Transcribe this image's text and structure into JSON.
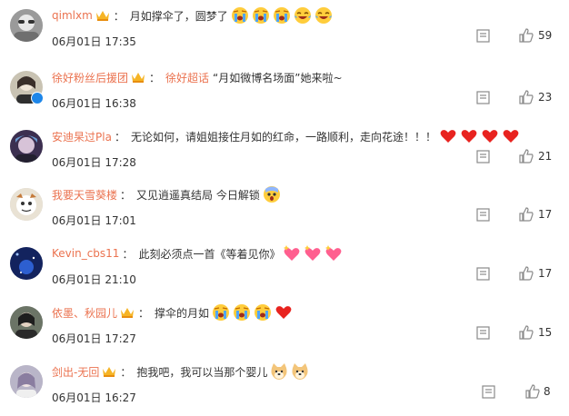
{
  "comments": [
    {
      "user": "qimlxm",
      "crown": true,
      "text": "月如撑伞了，圆梦了",
      "emojis": [
        "cry-face",
        "cry-face",
        "cry-face",
        "laugh-tears",
        "laugh-tears"
      ],
      "time": "06月01日 17:35",
      "likes": "59",
      "avatar": "#8a8a8a"
    },
    {
      "user": "徐好粉丝后援团",
      "crown": true,
      "verified": true,
      "mention": "徐好超话",
      "text": "“月如微博名场面”她来啦~",
      "emojis": [],
      "time": "06月01日 16:38",
      "likes": "23",
      "avatar": "#b7b3a6"
    },
    {
      "user": "安迪杲过Pla",
      "crown": false,
      "text": "无论如何，请姐姐接住月如的红命，一路顺利，走向花途！！！",
      "emojis": [
        "red-heart",
        "red-heart",
        "red-heart",
        "red-heart"
      ],
      "time": "06月01日 17:28",
      "likes": "21",
      "avatar": "#5a4b6b"
    },
    {
      "user": "我要天雪葵楼",
      "crown": false,
      "text": "又见逍遥真结局 今日解锁",
      "emojis": [
        "scared-face"
      ],
      "time": "06月01日 17:01",
      "likes": "17",
      "avatar": "#d8cfc0"
    },
    {
      "user": "Kevin_cbs11",
      "crown": false,
      "text": "此刻必须点一首《等着见你》",
      "emojis": [
        "sparkle-heart",
        "sparkle-heart",
        "sparkle-heart"
      ],
      "time": "06月01日 21:10",
      "likes": "17",
      "avatar": "#1f3c88"
    },
    {
      "user": "依墨、秋园儿",
      "crown": true,
      "text": "撑伞的月如",
      "emojis": [
        "cry-face",
        "cry-face",
        "cry-face",
        "red-heart"
      ],
      "time": "06月01日 17:27",
      "likes": "15",
      "avatar": "#4e5a4a"
    },
    {
      "user": "剑出-无回",
      "crown": true,
      "text": "抱我吧，我可以当那个婴儿",
      "emojis": [
        "doge",
        "doge"
      ],
      "time": "06月01日 16:27",
      "likes": "8",
      "avatar": "#a9a6b8"
    }
  ],
  "colors": {
    "username": "#eb7350",
    "text": "#333333",
    "verified": "#1d86e9"
  }
}
